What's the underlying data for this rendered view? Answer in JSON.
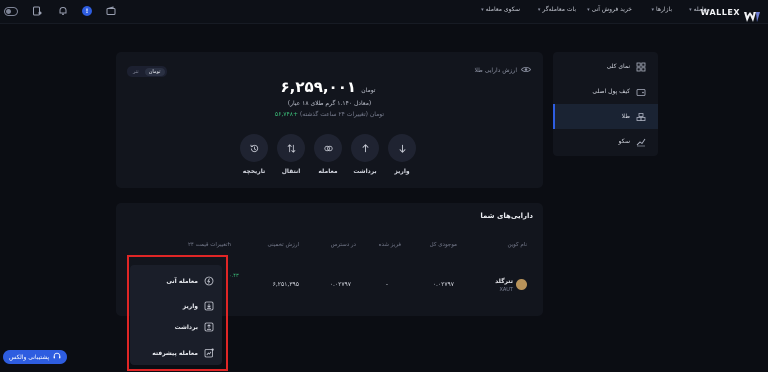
{
  "topbar": {
    "logo_text": "WALLEX",
    "nav": [
      {
        "label": "معامله"
      },
      {
        "label": "بازارها"
      },
      {
        "label": "خرید فروش آنی"
      },
      {
        "label": "بات معامله‌گر"
      },
      {
        "label": "سکوی معامله"
      }
    ],
    "notification_badge": "!"
  },
  "sidebar": {
    "items": [
      {
        "label": "نمای کلی",
        "icon": "grid-icon"
      },
      {
        "label": "کیف پول اصلی",
        "icon": "wallet-icon"
      },
      {
        "label": "طلا",
        "icon": "gold-bars-icon",
        "active": true
      },
      {
        "label": "سکو",
        "icon": "chart-icon"
      }
    ]
  },
  "gold_card": {
    "header_label": "ارزش دارایی طلا",
    "unit_options": [
      "تومان",
      "تتر"
    ],
    "selected_unit": "تومان",
    "balance": "۶,۲۵۹,۰۰۱",
    "balance_unit": "تومان",
    "equivalent": "(معادل ۱.۱۴۰ گرم طلای ۱۸ عیار)",
    "change_value": "+۵۶,۷۴۸",
    "change_text": "تومان (تغییرات ۲۴ ساعت گذشته)",
    "actions": [
      {
        "label": "واریز",
        "icon": "arrow-down-icon"
      },
      {
        "label": "برداشت",
        "icon": "arrow-up-icon"
      },
      {
        "label": "معامله",
        "icon": "exchange-icon"
      },
      {
        "label": "انتقال",
        "icon": "transfer-icon"
      },
      {
        "label": "تاریخچه",
        "icon": "history-icon"
      }
    ]
  },
  "assets": {
    "title": "دارایی‌های شما",
    "columns": [
      "نام کوین",
      "موجودی کل",
      "فریز شده",
      "در دسترس",
      "ارزش تخمینی",
      "تغییرات قیمت ۲۴h"
    ],
    "row": {
      "coin_name": "تترگلد",
      "coin_symbol": "XAUT",
      "total": "۰.۰۲۷۹۷",
      "frozen": "-",
      "available": "۰.۰۲۷۹۷",
      "estimated_value": "۶,۲۵۱,۳۹۵",
      "change_partial": "۰.۴۳"
    }
  },
  "dropdown": {
    "items": [
      {
        "label": "معامله آنی",
        "icon": "instant-trade-icon"
      },
      {
        "label": "واریز",
        "icon": "deposit-icon"
      },
      {
        "label": "برداشت",
        "icon": "withdraw-icon"
      },
      {
        "label": "معامله پیشرفته",
        "icon": "advanced-trade-icon"
      }
    ]
  },
  "support": {
    "label": "پشتیبانی والکس"
  },
  "colors": {
    "accent": "#2e5de0",
    "positive": "#3cc07a",
    "highlight": "#e02626",
    "background": "#0b0d13",
    "card": "#12151d"
  }
}
